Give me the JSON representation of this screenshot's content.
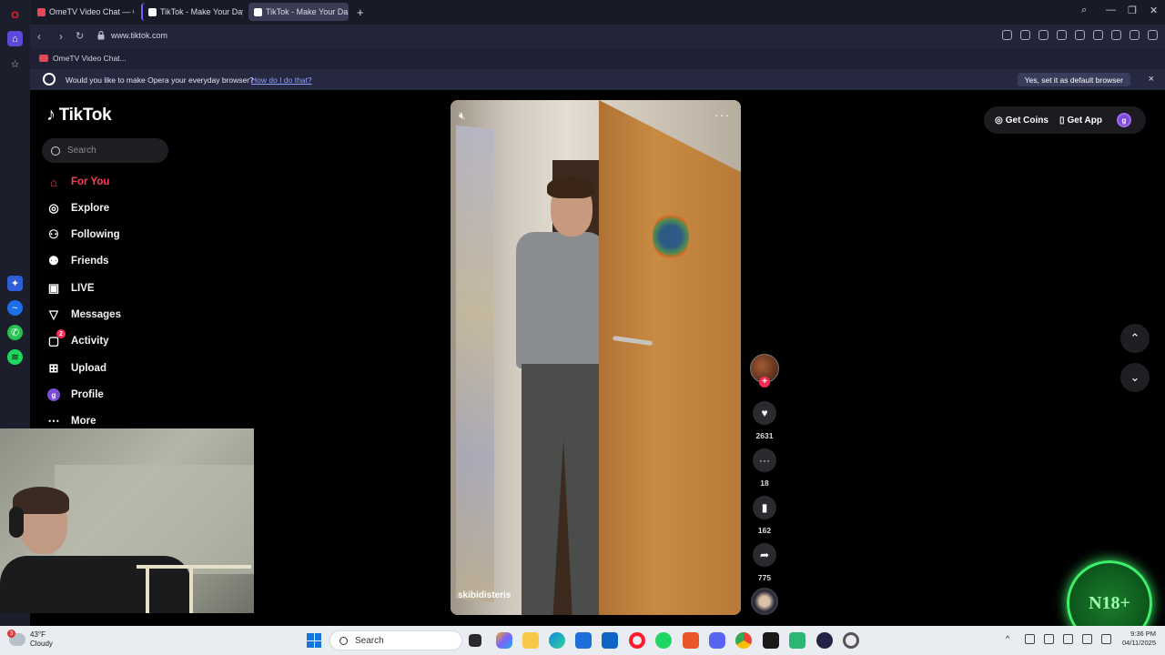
{
  "browser": {
    "tabs": [
      {
        "label": "OmeTV Video Chat — On",
        "fav": "#e24a5a"
      },
      {
        "label": "TikTok - Make Your Day",
        "fav": "#ffffff"
      },
      {
        "label": "TikTok - Make Your Da",
        "fav": "#ffffff"
      }
    ],
    "url": "www.tiktok.com",
    "bookmark": "OmeTV Video Chat...",
    "notice": {
      "message": "Would you like to make Opera your everyday browser?",
      "link": "How do I do that?",
      "accept": "Yes, set it as default browser",
      "close": "×"
    }
  },
  "tiktok": {
    "logo": "TikTok",
    "search_placeholder": "Search",
    "nav": [
      {
        "label": "For You",
        "icon": "home-icon",
        "glyph": "⌂"
      },
      {
        "label": "Explore",
        "icon": "compass-icon",
        "glyph": "◎"
      },
      {
        "label": "Following",
        "icon": "following-icon",
        "glyph": "⚇"
      },
      {
        "label": "Friends",
        "icon": "friends-icon",
        "glyph": "⚉"
      },
      {
        "label": "LIVE",
        "icon": "live-icon",
        "glyph": "▣"
      },
      {
        "label": "Messages",
        "icon": "messages-icon",
        "glyph": "▽"
      },
      {
        "label": "Activity",
        "icon": "activity-icon",
        "glyph": "▢",
        "badge": "2"
      },
      {
        "label": "Upload",
        "icon": "upload-icon",
        "glyph": "⊞"
      },
      {
        "label": "Profile",
        "icon": "profile-icon",
        "glyph": "g"
      },
      {
        "label": "More",
        "icon": "more-icon",
        "glyph": "⋯"
      }
    ],
    "header": {
      "coins": "Get Coins",
      "app": "Get App",
      "avatar_letter": "g"
    },
    "video": {
      "username": "skibidisteris",
      "likes": "2631",
      "comments": "18",
      "saves": "162",
      "shares": "775"
    }
  },
  "overlay": {
    "badge_text": "N18+"
  },
  "taskbar": {
    "weather_temp": "43°F",
    "weather_desc": "Cloudy",
    "weather_badge": "3",
    "search_label": "Search",
    "time": "9:36 PM",
    "date": "04/11/2025"
  }
}
